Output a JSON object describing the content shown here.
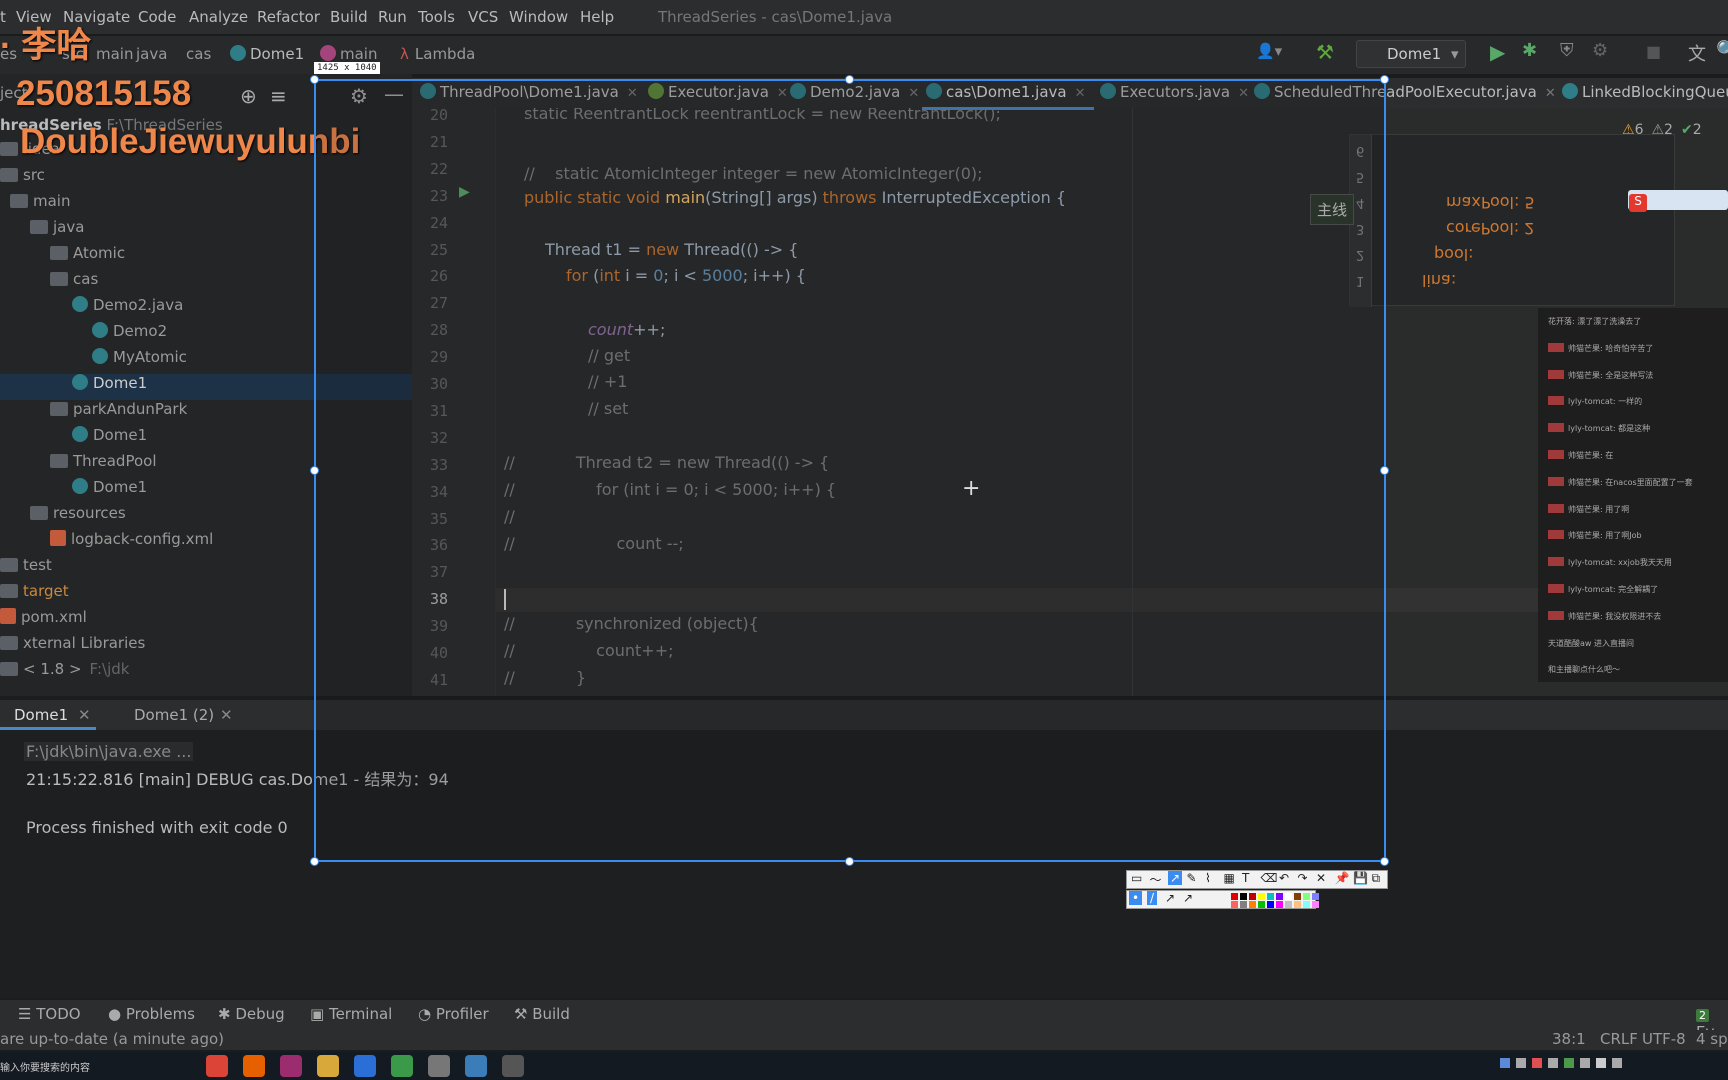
{
  "menu": {
    "items": [
      "t",
      "View",
      "Navigate",
      "Code",
      "Analyze",
      "Refactor",
      "Build",
      "Run",
      "Tools",
      "VCS",
      "Window",
      "Help"
    ],
    "window_title": "ThreadSeries - cas\\Dome1.java"
  },
  "navbar": {
    "crumbs": [
      "es",
      "src",
      "main",
      "java",
      "cas",
      "Dome1",
      "main",
      "Lambda"
    ],
    "run_config": "Dome1"
  },
  "overlay": {
    "name": "· 李哈",
    "number": "250815158",
    "handle": "DoubleJiewuyulunbi"
  },
  "project": {
    "header": "ject",
    "root": "hreadSeries",
    "root_path": "F:\\ThreadSeries",
    "items": [
      {
        "label": ".idea",
        "kind": "folder",
        "indent": 0
      },
      {
        "label": "src",
        "kind": "folder",
        "indent": 0
      },
      {
        "label": "main",
        "kind": "folder",
        "indent": 1
      },
      {
        "label": "java",
        "kind": "folder",
        "indent": 2
      },
      {
        "label": "Atomic",
        "kind": "folder",
        "indent": 3
      },
      {
        "label": "cas",
        "kind": "folder",
        "indent": 3
      },
      {
        "label": "Demo2.java",
        "kind": "class",
        "indent": 4
      },
      {
        "label": "Demo2",
        "kind": "class",
        "indent": 5
      },
      {
        "label": "MyAtomic",
        "kind": "class",
        "indent": 5
      },
      {
        "label": "Dome1",
        "kind": "class",
        "indent": 4
      },
      {
        "label": "parkAndunPark",
        "kind": "folder",
        "indent": 3
      },
      {
        "label": "Dome1",
        "kind": "class",
        "indent": 4
      },
      {
        "label": "ThreadPool",
        "kind": "folder",
        "indent": 3
      },
      {
        "label": "Dome1",
        "kind": "class",
        "indent": 4
      },
      {
        "label": "resources",
        "kind": "folder",
        "indent": 2
      },
      {
        "label": "logback-config.xml",
        "kind": "xml",
        "indent": 3
      },
      {
        "label": "test",
        "kind": "folder",
        "indent": 0
      },
      {
        "label": "target",
        "kind": "folder",
        "indent": 0
      },
      {
        "label": "pom.xml",
        "kind": "xml",
        "indent": 0
      },
      {
        "label": "xternal Libraries",
        "kind": "lib",
        "indent": 0
      },
      {
        "label": "< 1.8 >",
        "kind": "lib",
        "indent": 0,
        "extra": "F:\\jdk"
      }
    ]
  },
  "tabs": [
    {
      "label": "ThreadPool\\Dome1.java"
    },
    {
      "label": "Executor.java"
    },
    {
      "label": "Demo2.java"
    },
    {
      "label": "cas\\Dome1.java"
    },
    {
      "label": "Executors.java"
    },
    {
      "label": "ScheduledThreadPoolExecutor.java"
    },
    {
      "label": "LinkedBlockingQueu"
    }
  ],
  "inspection": {
    "warnings": "6",
    "weak": "2",
    "ok": "2"
  },
  "code": {
    "line_numbers": [
      "20",
      "21",
      "22",
      "23",
      "24",
      "25",
      "26",
      "27",
      "28",
      "29",
      "30",
      "31",
      "32",
      "33",
      "34",
      "35",
      "36",
      "37",
      "38",
      "39",
      "40",
      "41"
    ],
    "l20": "static ReentrantLock reentrantLock = new ReentrantLock();",
    "l22": "//    static AtomicInteger integer = new AtomicInteger(0);",
    "l23_a": "public static void ",
    "l23_fn": "main",
    "l23_b": "(String[] args) ",
    "l23_kw": "throws",
    "l23_c": " InterruptedException {",
    "l25_a": "Thread t1 = ",
    "l25_kw": "new",
    "l25_b": " Thread(() -> {",
    "l26_kw": "for",
    "l26_a": " (",
    "l26_kw2": "int",
    "l26_b": " i = ",
    "l26_n1": "0",
    "l26_c": "; i < ",
    "l26_n2": "5000",
    "l26_d": "; i++) {",
    "l28_var": "count",
    "l28_op": "++;",
    "l29": "// get",
    "l30": "// +1",
    "l31": "// set",
    "l33": "//            Thread t2 = new Thread(() -> {",
    "l34": "//                for (int i = 0; i < 5000; i++) {",
    "l35": "//",
    "l36": "//                    count --;",
    "l39": "//            synchronized (object){",
    "l40": "//                count++;",
    "l41": "//            }"
  },
  "floatpanel": {
    "lines": [
      "maxPool: 5",
      "corePool: 2",
      "pool:",
      "lina:"
    ],
    "numbers": [
      "6",
      "5",
      "4",
      "3",
      "2",
      "1"
    ],
    "badge": "主线"
  },
  "chat": [
    "花开落: 漂了漂了洗澡去了",
    "帅猫芒果: 哈奇怕辛苦了",
    "帅猫芒果: 全是这种写法",
    "lyly-tomcat: 一样的",
    "lyly-tomcat: 都是这种",
    "帅猫芒果: 在",
    "帅猫芒果: 在nacos里面配置了一套",
    "帅猫芒果: 用了啊",
    "帅猫芒果: 用了啊Job",
    "lyly-tomcat: xxjob我天天用",
    "lyly-tomcat: 完全解耦了",
    "帅猫芒果: 我没权限进不去",
    "天道酷酸aw 进入直播间",
    "和主播聊点什么吧～"
  ],
  "run": {
    "tabs": [
      "Dome1",
      "Dome1 (2)"
    ],
    "cmd": "F:\\jdk\\bin\\java.exe ...",
    "log": "21:15:22.816 [main] DEBUG cas.Dome1 - 结果为：94",
    "exit": "Process finished with exit code 0"
  },
  "screenshot_tool": {
    "size_label": "1425 x 1040"
  },
  "bottom_tools": [
    "TODO",
    "Problems",
    "Debug",
    "Terminal",
    "Profiler",
    "Build"
  ],
  "event_log": "Ev",
  "event_count": "2",
  "status": {
    "message": "are up-to-date (a minute ago)",
    "position": "38:1",
    "line_sep": "CRLF",
    "encoding": "UTF-8",
    "indent": "4 sp"
  },
  "taskbar": {
    "search": "输入你要搜索的内容"
  },
  "colors": {
    "accent": "#3b8cf0",
    "keyword": "#cc7832",
    "overlay_text": "#f0874a"
  }
}
